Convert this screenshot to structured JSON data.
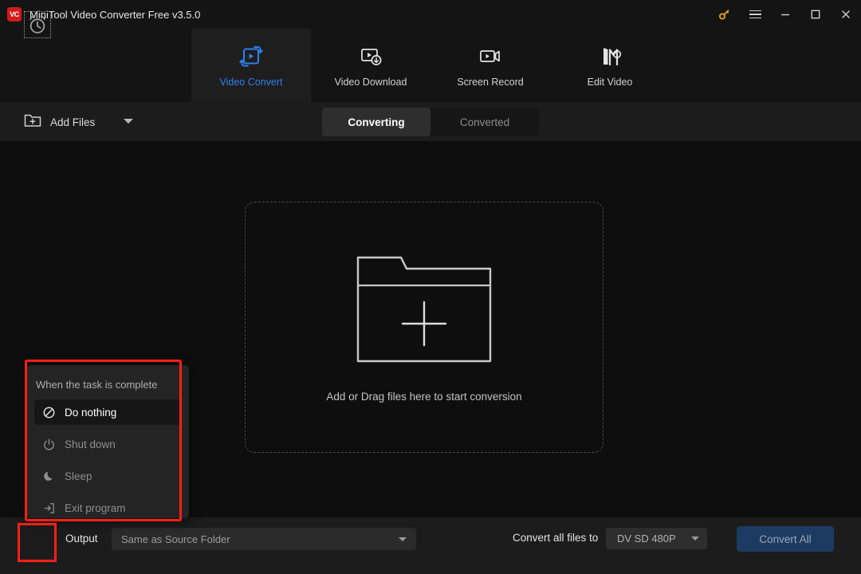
{
  "window": {
    "title": "MiniTool Video Converter Free v3.5.0",
    "logo_text": "VC",
    "controls": {
      "key": "key-icon",
      "menu": "hamburger-icon",
      "minimize": "minimize-icon",
      "maximize": "maximize-icon",
      "close": "close-icon"
    },
    "accent_color": "#2f80ed",
    "logo_color": "#d4191c",
    "key_color": "#e8a317"
  },
  "nav": {
    "tabs": [
      {
        "label": "Video Convert",
        "icon": "video-convert-icon",
        "active": true
      },
      {
        "label": "Video Download",
        "icon": "video-download-icon",
        "active": false
      },
      {
        "label": "Screen Record",
        "icon": "screen-record-icon",
        "active": false
      },
      {
        "label": "Edit Video",
        "icon": "edit-video-icon",
        "active": false
      }
    ]
  },
  "toolbar": {
    "add_files_label": "Add Files",
    "add_files_icon": "folder-plus-icon",
    "dropdown_icon": "caret-down-icon",
    "segments": [
      {
        "label": "Converting",
        "active": true
      },
      {
        "label": "Converted",
        "active": false
      }
    ]
  },
  "dropzone": {
    "icon": "folder-plus-large-icon",
    "text": "Add or Drag files here to start conversion"
  },
  "popup": {
    "header": "When the task is complete",
    "items": [
      {
        "label": "Do nothing",
        "icon": "ban-icon",
        "selected": true
      },
      {
        "label": "Shut down",
        "icon": "power-icon",
        "selected": false
      },
      {
        "label": "Sleep",
        "icon": "moon-icon",
        "selected": false
      },
      {
        "label": "Exit program",
        "icon": "exit-arrow-icon",
        "selected": false
      }
    ]
  },
  "bottom": {
    "clock_icon": "alarm-clock-icon",
    "output_label": "Output",
    "output_value": "Same as Source Folder",
    "convert_to_label": "Convert all files to",
    "format_value": "DV SD 480P",
    "convert_all_label": "Convert All",
    "convert_all_color": "#1d3a63"
  },
  "annotations": {
    "color": "#fe1f17",
    "boxes": [
      "task-complete-menu",
      "schedule-clock-button"
    ]
  }
}
